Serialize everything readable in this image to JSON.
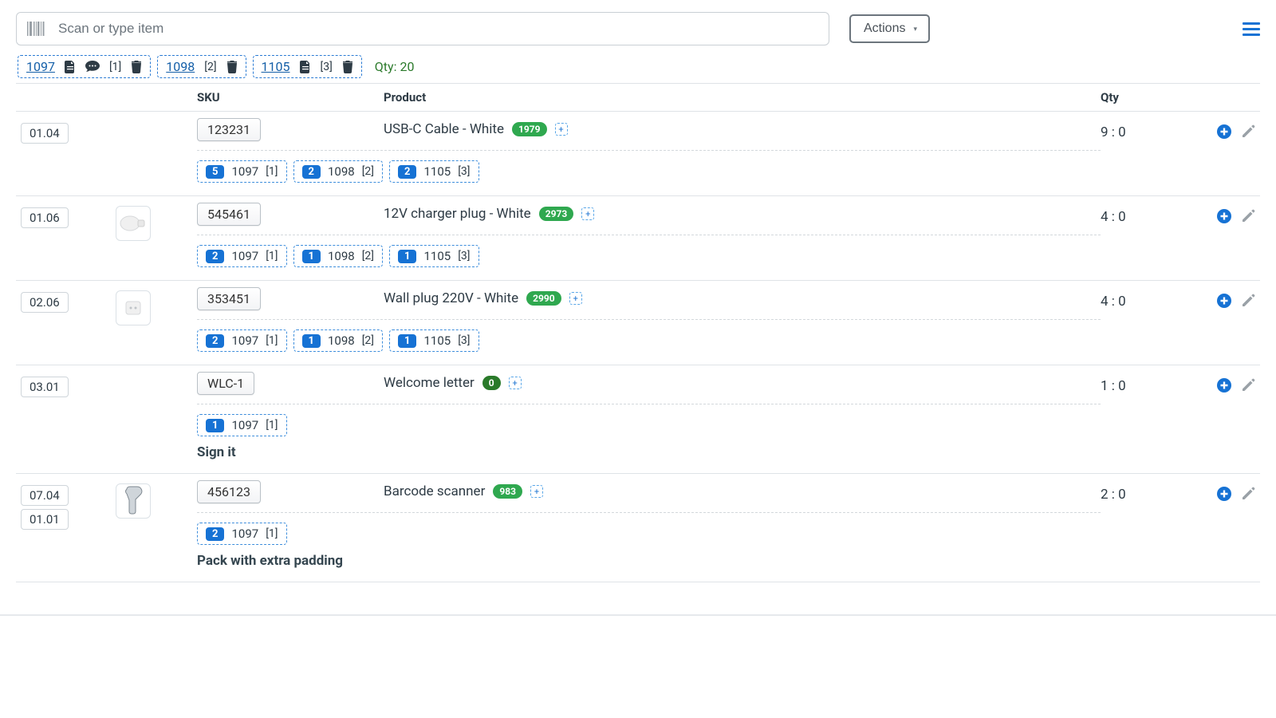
{
  "search": {
    "placeholder": "Scan or type item"
  },
  "actions_label": "Actions",
  "qty_label": "Qty:",
  "qty_total": "20",
  "order_tabs": [
    {
      "num": "1097",
      "idx": "[1]",
      "has_note_icon": true,
      "has_chat": true
    },
    {
      "num": "1098",
      "idx": "[2]",
      "has_note_icon": false,
      "has_chat": false
    },
    {
      "num": "1105",
      "idx": "[3]",
      "has_note_icon": true,
      "has_chat": false
    }
  ],
  "headers": {
    "sku": "SKU",
    "product": "Product",
    "qty": "Qty"
  },
  "rows": [
    {
      "bins": [
        "01.04"
      ],
      "thumb": null,
      "sku": "123231",
      "name": "USB-C Cable - White",
      "stock": "1979",
      "stock_zero": false,
      "qty": "9 : 0",
      "alloc": [
        {
          "cnt": "5",
          "ord": "1097",
          "idx": "[1]"
        },
        {
          "cnt": "2",
          "ord": "1098",
          "idx": "[2]"
        },
        {
          "cnt": "2",
          "ord": "1105",
          "idx": "[3]"
        }
      ],
      "note": ""
    },
    {
      "bins": [
        "01.06"
      ],
      "thumb": "charger",
      "sku": "545461",
      "name": "12V charger plug - White",
      "stock": "2973",
      "stock_zero": false,
      "qty": "4 : 0",
      "alloc": [
        {
          "cnt": "2",
          "ord": "1097",
          "idx": "[1]"
        },
        {
          "cnt": "1",
          "ord": "1098",
          "idx": "[2]"
        },
        {
          "cnt": "1",
          "ord": "1105",
          "idx": "[3]"
        }
      ],
      "note": ""
    },
    {
      "bins": [
        "02.06"
      ],
      "thumb": "plug",
      "sku": "353451",
      "name": "Wall plug 220V - White",
      "stock": "2990",
      "stock_zero": false,
      "qty": "4 : 0",
      "alloc": [
        {
          "cnt": "2",
          "ord": "1097",
          "idx": "[1]"
        },
        {
          "cnt": "1",
          "ord": "1098",
          "idx": "[2]"
        },
        {
          "cnt": "1",
          "ord": "1105",
          "idx": "[3]"
        }
      ],
      "note": ""
    },
    {
      "bins": [
        "03.01"
      ],
      "thumb": null,
      "sku": "WLC-1",
      "name": "Welcome letter",
      "stock": "0",
      "stock_zero": true,
      "qty": "1 : 0",
      "alloc": [
        {
          "cnt": "1",
          "ord": "1097",
          "idx": "[1]"
        }
      ],
      "note": "Sign it"
    },
    {
      "bins": [
        "07.04",
        "01.01"
      ],
      "thumb": "scanner",
      "sku": "456123",
      "name": "Barcode scanner",
      "stock": "983",
      "stock_zero": false,
      "qty": "2 : 0",
      "alloc": [
        {
          "cnt": "2",
          "ord": "1097",
          "idx": "[1]"
        }
      ],
      "note": "Pack with extra padding"
    }
  ]
}
